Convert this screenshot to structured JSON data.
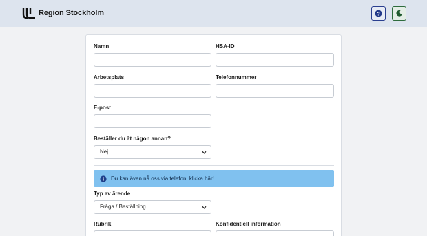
{
  "header": {
    "brand": "Region Stockholm",
    "logo_icon": "region-stockholm-logo-icon",
    "help_icon": "help-icon",
    "theme_icon": "moon-icon"
  },
  "form": {
    "name_label": "Namn",
    "hsa_label": "HSA-ID",
    "workplace_label": "Arbetsplats",
    "phone_label": "Telefonnummer",
    "email_label": "E-post",
    "on_behalf_label": "Beställer du åt någon annan?",
    "on_behalf_value": "Nej",
    "info_text": "Du kan även nå oss via telefon, klicka här!",
    "type_label": "Typ av ärende",
    "type_value": "Fråga / Beställning",
    "subject_label": "Rubrik",
    "confidential_label": "Konfidentiell information"
  },
  "colors": {
    "header_bg": "#dde4ee",
    "info_bg": "#80c1ef",
    "help_border": "#2a3f8f",
    "theme_border": "#2d6b3c"
  }
}
